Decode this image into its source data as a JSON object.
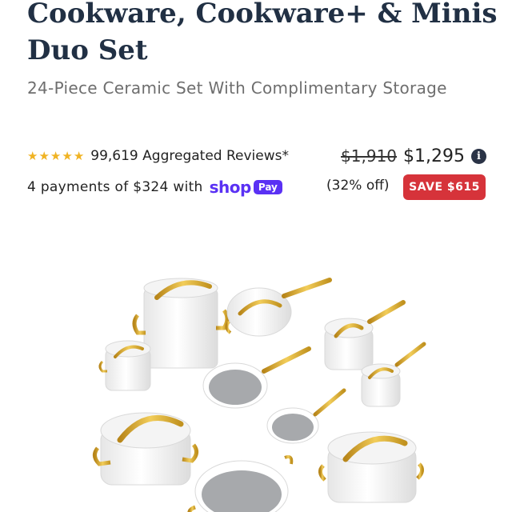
{
  "product": {
    "title": "Cookware, Cookware+ & Minis Duo Set",
    "subtitle": "24-Piece Ceramic Set With Complimentary Storage",
    "rating": {
      "stars": 5,
      "reviews_text": "99,619 Aggregated Reviews*"
    },
    "price": {
      "original": "$1,910",
      "sale": "$1,295",
      "percent_off": "(32% off)",
      "save_label": "SAVE $615"
    },
    "installments": {
      "text": "4 payments of $324 with",
      "provider_logo_text": "shop",
      "provider_badge_text": "Pay"
    }
  },
  "colors": {
    "title": "#213044",
    "accent_save": "#d6333a",
    "star": "#f0b323",
    "shop_pay": "#5a31f4",
    "cookware_body": "#ffffff",
    "cookware_interior": "#a7a9ac",
    "handle_gold": "#d4a62a"
  },
  "icons": [
    "star-icon",
    "info-icon",
    "shop-pay-logo"
  ]
}
